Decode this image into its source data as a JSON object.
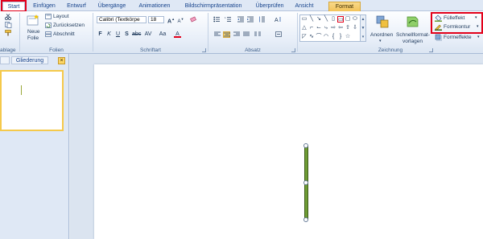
{
  "tabs": [
    "Start",
    "Einfügen",
    "Entwurf",
    "Übergänge",
    "Animationen",
    "Bildschirmpräsentation",
    "Überprüfen",
    "Ansicht",
    "Format"
  ],
  "ribbon": {
    "clipboard": {
      "label": "ablage"
    },
    "slides": {
      "label": "Folien",
      "new_slide_line1": "Neue",
      "new_slide_line2": "Folie",
      "layout": "Layout",
      "reset": "Zurücksetzen",
      "section": "Abschnitt"
    },
    "font": {
      "label": "Schriftart",
      "font_name": "Calibri (Textkörpe",
      "font_size": "18"
    },
    "paragraph": {
      "label": "Absatz"
    },
    "drawing": {
      "label": "Zeichnung",
      "arrange_line1": "Anordnen",
      "quickstyles_line1": "Schnellformat-",
      "quickstyles_line2": "vorlagen",
      "fill": "Fülleffekt",
      "outline": "Formkontur",
      "effects": "Formeffekte"
    }
  },
  "panel": {
    "tab_outline": "Gliederung",
    "close_glyph": "×"
  },
  "colors": {
    "highlight_red": "#e2001a",
    "shape_green": "#6e9b34",
    "format_tab": "#f3c35a"
  }
}
